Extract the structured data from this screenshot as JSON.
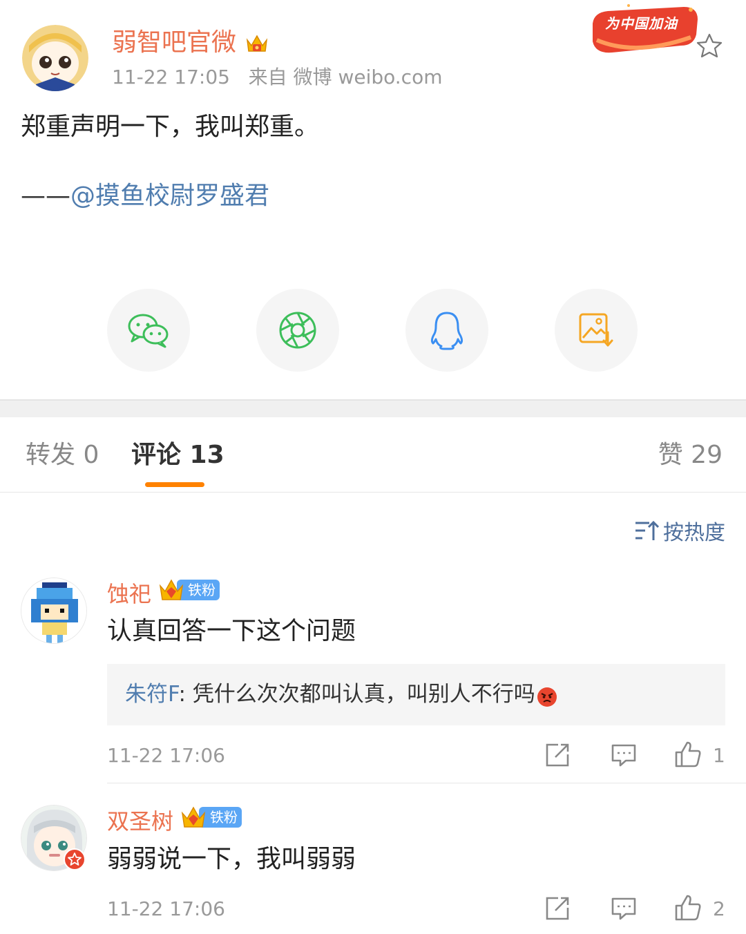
{
  "post": {
    "author": "弱智吧官微",
    "time": "11-22 17:05",
    "source": "来自 微博 weibo.com",
    "promo_badge": "为中国加油",
    "text": "郑重声明一下，我叫郑重。",
    "credit_dash": "——",
    "credit_mention": "@摸鱼校尉罗盛君"
  },
  "share": {
    "icons": [
      "wechat-icon",
      "moments-icon",
      "qq-icon",
      "save-image-icon"
    ]
  },
  "tabs": {
    "repost": "转发 0",
    "comments": "评论 13",
    "likes": "赞 29"
  },
  "sort": {
    "label": "按热度"
  },
  "comments": [
    {
      "user": "蚀祀",
      "badge": "铁粉",
      "text": "认真回答一下这个问题",
      "reply": {
        "user": "朱符F",
        "sep": ":",
        "text": " 凭什么次次都叫认真，叫别人不行吗"
      },
      "time": "11-22 17:06",
      "likes": "1"
    },
    {
      "user": "双圣树",
      "badge": "铁粉",
      "text": "弱弱说一下，我叫弱弱",
      "time": "11-22 17:06",
      "likes": "2"
    }
  ],
  "colors": {
    "accent": "#ff8200",
    "username": "#eb7350",
    "link": "#507daf",
    "fan_badge": "#5aa6f5"
  }
}
